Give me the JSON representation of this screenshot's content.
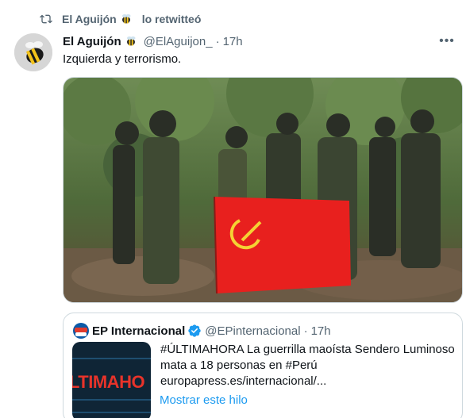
{
  "retweet": {
    "user": "El Aguijón",
    "suffix": "lo retwitteó"
  },
  "tweet": {
    "display_name": "El Aguijón",
    "handle": "@ElAguijon_",
    "separator": "·",
    "time": "17h",
    "text": "Izquierda y terrorismo.",
    "image": {
      "description_icon": "photo-icon"
    }
  },
  "quote": {
    "display_name": "EP Internacional",
    "handle": "@EPinternacional",
    "separator": "·",
    "time": "17h",
    "text": "#ÚLTIMAHORA La guerrilla maoísta Sendero Luminoso mata a 18 personas en #Perú europapress.es/internacional/...",
    "thumbnail_text": "LTIMAHO",
    "show_thread": "Mostrar este hilo"
  },
  "colors": {
    "secondary_text": "#536471",
    "link": "#1d9bf0",
    "verified": "#1d9bf0",
    "flag": "#e8201e"
  }
}
